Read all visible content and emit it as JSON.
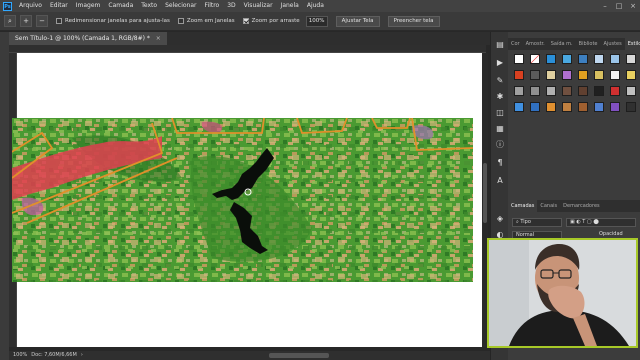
{
  "menubar": {
    "app_icon": "photoshop-logo",
    "items": [
      "Arquivo",
      "Editar",
      "Imagem",
      "Camada",
      "Texto",
      "Selecionar",
      "Filtro",
      "3D",
      "Visualizar",
      "Janela",
      "Ajuda"
    ]
  },
  "options": {
    "tool_icon": "search-icon",
    "zoom_in_icon": "zoom-in-icon",
    "zoom_out_icon": "zoom-out-icon",
    "resize_windows_label": "Redimensionar janelas para ajusta-las",
    "zoom_all_windows_label": "Zoom em Janelas",
    "scrubby_zoom_label": "Zoom por arraste",
    "zoom_value": "100%",
    "fit_screen_label": "Ajustar Tela",
    "fill_screen_label": "Preencher tela",
    "resize_checked": false,
    "zoom_all_checked": false,
    "scrubby_checked": true
  },
  "document": {
    "tab_title": "Sem Título-1 @ 100% (Camada 1, RGB/8#) *",
    "close_symbol": "×"
  },
  "status": {
    "zoom": "100%",
    "doc_size": "Doc: 7,60M/6,66M",
    "arrow": "›"
  },
  "panels": {
    "top_tabs": [
      "Cor",
      "Amostr.",
      "Saída m.",
      "Bibliote",
      "Ajustes",
      "Estilos"
    ],
    "active_top_tab": "Estilos",
    "layers_tabs": [
      "Camadas",
      "Canais",
      "Demarcadores"
    ],
    "active_layers_tab": "Camadas",
    "layer_filter": "Tipo",
    "blend_mode": "Normal",
    "opacity_label": "Opacidad"
  },
  "colors": {
    "accent_webcam_border": "#a7c928",
    "contour_orange": "#e0902a",
    "urban_red": "#e04050",
    "forest_green": "#3f8f2c"
  }
}
